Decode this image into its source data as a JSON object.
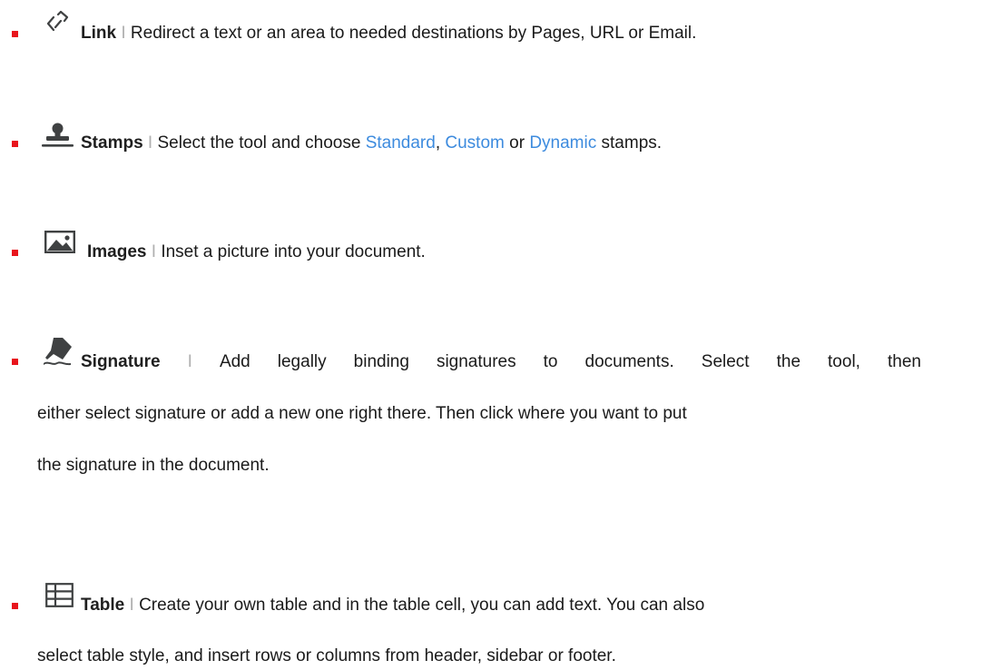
{
  "colors": {
    "bullet": "#e8151c",
    "link": "#3d8bde",
    "separator": "#b0b0b0",
    "icon": "#3f4142"
  },
  "items": [
    {
      "icon": "link-icon",
      "term": "Link",
      "separator": "I",
      "text": "Redirect a text or an area to needed destinations by Pages, URL or Email."
    },
    {
      "icon": "stamp-icon",
      "term": "Stamps",
      "separator": "I",
      "text_before": "Select the tool and choose",
      "option_1": "Standard",
      "comma": ",",
      "option_2": "Custom",
      "or": "or",
      "option_3": "Dynamic",
      "text_after": "stamps."
    },
    {
      "icon": "image-icon",
      "term": "Images",
      "separator": "I",
      "text": "Inset a picture into your document."
    },
    {
      "icon": "signature-icon",
      "term": "Signature",
      "separator": "I",
      "line_1_words": [
        "Add",
        "legally",
        "binding",
        "signatures",
        "to",
        "documents.",
        "Select",
        "the",
        "tool,",
        "then"
      ],
      "line_2": "either select signature or add a new one right there. Then click where you want to put",
      "line_3": "the signature in the document."
    },
    {
      "icon": "table-icon",
      "term": "Table",
      "separator": "I",
      "line_1": "Create your own table and in the table cell, you can add text. You can also",
      "line_2": "select table style, and insert rows or columns from header, sidebar or footer."
    }
  ]
}
